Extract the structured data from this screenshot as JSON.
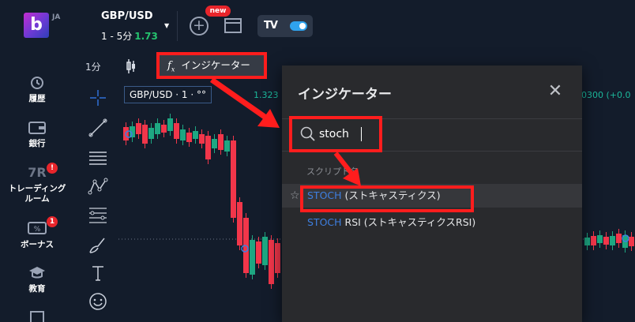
{
  "app": {
    "logo_letter": "b",
    "lang": "JA"
  },
  "header": {
    "pair": "GBP/USD",
    "interval": "1 - 5分",
    "change": "1.73",
    "new_badge": "new"
  },
  "sidebar": {
    "items": [
      {
        "label": "履歴",
        "icon": "history-icon"
      },
      {
        "label": "銀行",
        "icon": "wallet-icon"
      },
      {
        "label": "トレーディングルーム",
        "label_line1": "トレーディング",
        "label_line2": "ルーム",
        "icon": "trading-room-icon",
        "badge": "!"
      },
      {
        "label": "ボーナス",
        "icon": "bonus-icon",
        "badge": "1"
      },
      {
        "label": "教育",
        "icon": "education-icon"
      }
    ]
  },
  "toolbar": {
    "timeframe": "1分",
    "indicators_label": "インジケーター",
    "fx_symbol": "f",
    "fx_sub": "x"
  },
  "chart": {
    "symbol_label": "GBP/USD · 1 · ",
    "symbol_label_tail": "°°",
    "price_left": "1.323",
    "price_right": "0300 (+0.0"
  },
  "dialog": {
    "title": "インジケーター",
    "search_value": "stoch",
    "section_label": "スクリプト名",
    "results": [
      {
        "keyword": "STOCH",
        "rest": " (ストキャスティクス)"
      },
      {
        "keyword": "STOCH",
        "rest": " RSI (ストキャスティクスRSI)"
      }
    ]
  },
  "colors": {
    "background": "#131c2b",
    "dialog": "#292a2d",
    "highlight": "#ff1d1d",
    "up_candle": "#1ea782",
    "down_candle": "#f2364a",
    "accent_blue": "#3e7fe0",
    "change_green": "#25c26e"
  }
}
